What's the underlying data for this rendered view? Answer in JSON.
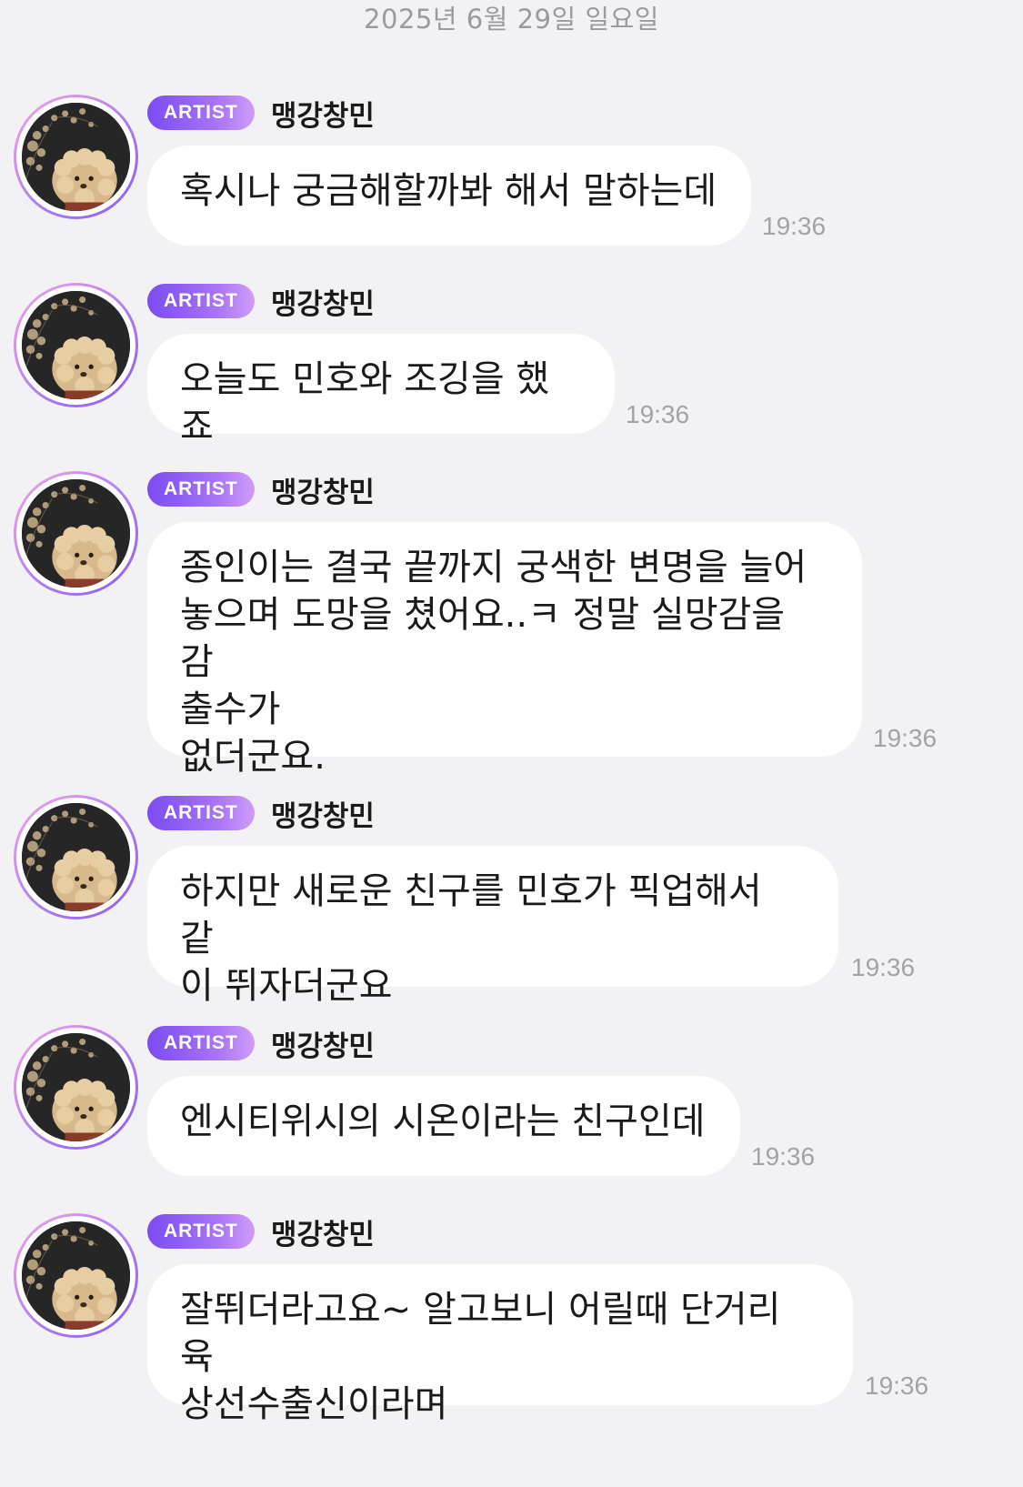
{
  "date_header": "2025년 6월 29일 일요일",
  "badge_label": "ARTIST",
  "messages": [
    {
      "sender": "맹강창민",
      "text": "혹시나 궁금해할까봐 해서 말하는데",
      "time": "19:36"
    },
    {
      "sender": "맹강창민",
      "text": "오늘도 민호와 조깅을 했죠",
      "time": "19:36"
    },
    {
      "sender": "맹강창민",
      "text": "종인이는 결국 끝까지 궁색한 변명을 늘어\n놓으며 도망을 쳤어요..ㅋ 정말 실망감을 감\n출수가\n없더군요.",
      "time": "19:36"
    },
    {
      "sender": "맹강창민",
      "text": "하지만 새로운 친구를 민호가 픽업해서 같\n이 뛰자더군요",
      "time": "19:36"
    },
    {
      "sender": "맹강창민",
      "text": "엔시티위시의 시온이라는 친구인데",
      "time": "19:36"
    },
    {
      "sender": "맹강창민",
      "text": "잘뛰더라고요~ 알고보니 어릴때 단거리 육\n상선수출신이라며",
      "time": "19:36"
    }
  ],
  "colors": {
    "background": "#f2f2f5",
    "bubble": "#ffffff",
    "badge_start": "#7b4bf2",
    "badge_end": "#cf9cf8",
    "time_text": "#a2a2a8"
  },
  "icons": {
    "avatar": "dog-profile-photo"
  }
}
